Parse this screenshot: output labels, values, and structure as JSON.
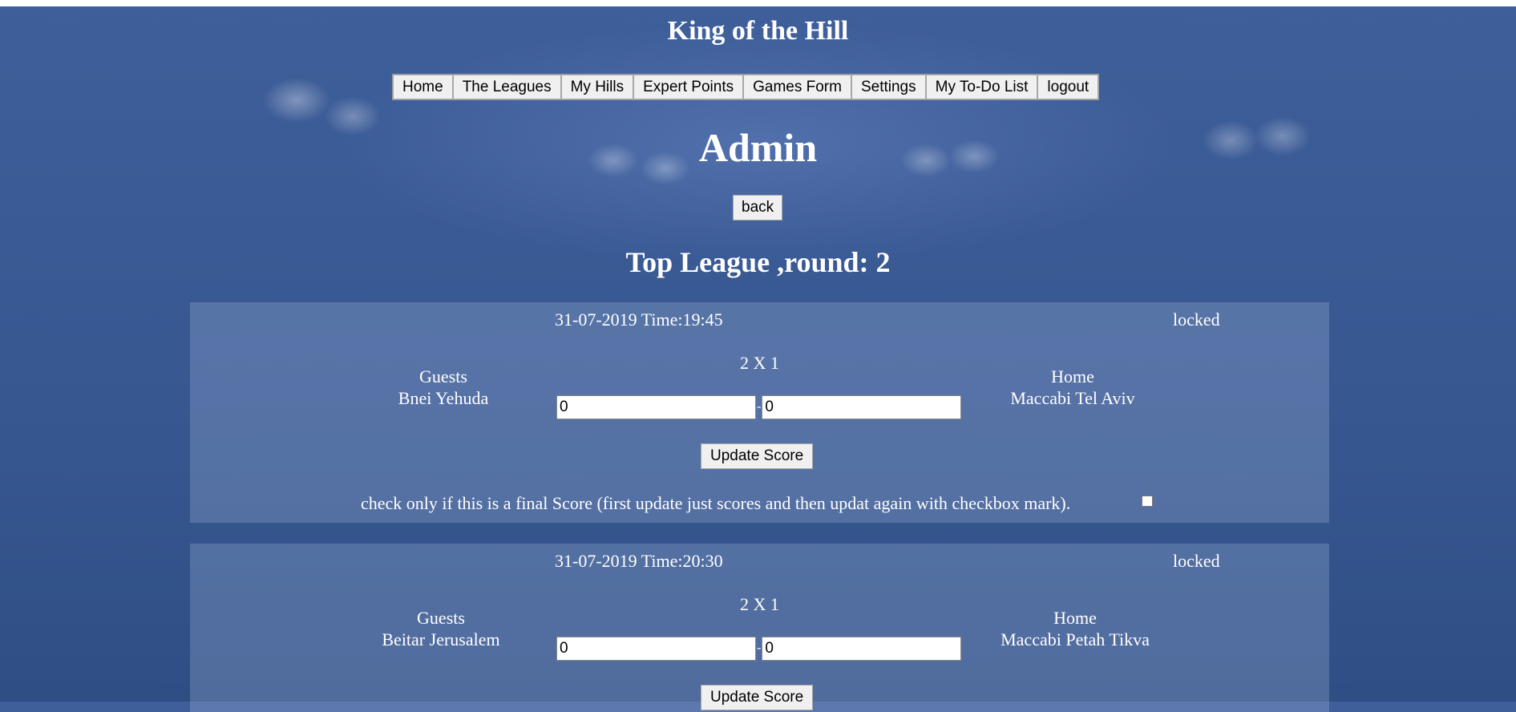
{
  "app": {
    "title": "King of the Hill"
  },
  "nav": {
    "items": [
      {
        "label": "Home"
      },
      {
        "label": "The Leagues"
      },
      {
        "label": "My Hills"
      },
      {
        "label": "Expert Points"
      },
      {
        "label": "Games Form"
      },
      {
        "label": "Settings"
      },
      {
        "label": "My To-Do List"
      },
      {
        "label": "logout"
      }
    ]
  },
  "page": {
    "title": "Admin",
    "back_label": "back",
    "round_title": "Top League ,round: 2"
  },
  "games": [
    {
      "date_time": "31-07-2019 Time:19:45",
      "status": "locked",
      "odds": "2 X 1",
      "guests_label": "Guests",
      "guests_team": "Bnei Yehuda",
      "home_label": "Home",
      "home_team": "Maccabi Tel Aviv",
      "guest_score": "0",
      "home_score": "0",
      "separator": "-",
      "update_label": "Update Score",
      "final_note": "check only if this is a final Score (first update just scores and then updat again with checkbox mark)."
    },
    {
      "date_time": "31-07-2019 Time:20:30",
      "status": "locked",
      "odds": "2 X 1",
      "guests_label": "Guests",
      "guests_team": "Beitar Jerusalem",
      "home_label": "Home",
      "home_team": "Maccabi Petah Tikva",
      "guest_score": "0",
      "home_score": "0",
      "separator": "-",
      "update_label": "Update Score"
    }
  ]
}
